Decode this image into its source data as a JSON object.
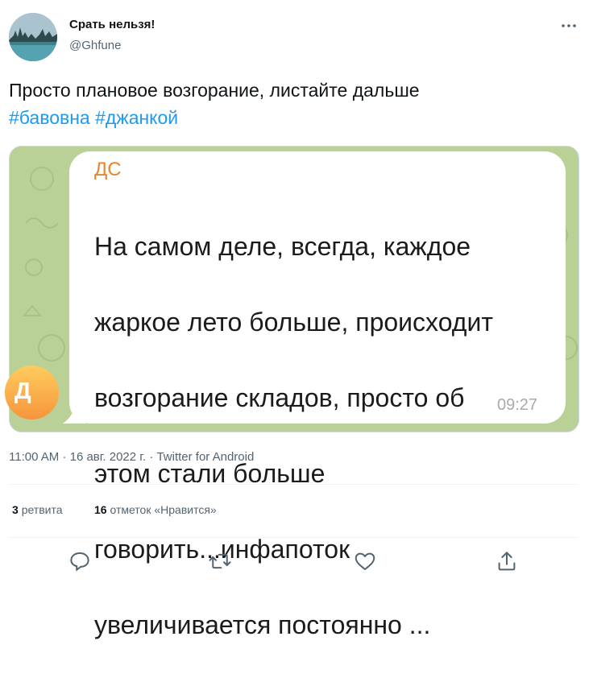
{
  "author": {
    "display_name": "Срать нельзя!",
    "handle": "@Ghfune"
  },
  "tweet": {
    "text": "Просто плановое возгорание, листайте дальше",
    "hashtags": [
      "#бавовна",
      "#джанкой"
    ]
  },
  "media": {
    "chat_avatar_letter": "Д",
    "sender": "ДС",
    "message_lines": [
      "На самом деле, всегда, каждое",
      "жаркое лето больше, происходит",
      "возгорание складов, просто об",
      "этом стали больше",
      "говорить...инфапоток",
      "увеличивается постоянно ..."
    ],
    "time": "09:27"
  },
  "meta": {
    "time": "11:00 AM",
    "separator": "·",
    "date": "16 авг. 2022 г.",
    "source": "Twitter for Android"
  },
  "stats": {
    "retweets_count": "3",
    "retweets_label": "ретвита",
    "likes_count": "16",
    "likes_label": "отметок «Нравится»"
  },
  "colors": {
    "hashtag": "#1d9bf0",
    "sender": "#e8862e",
    "chat_background": "#b7cf95"
  },
  "icons": {
    "more": "more-dots-icon",
    "reply": "reply-icon",
    "retweet": "retweet-icon",
    "like": "heart-icon",
    "share": "share-icon"
  }
}
